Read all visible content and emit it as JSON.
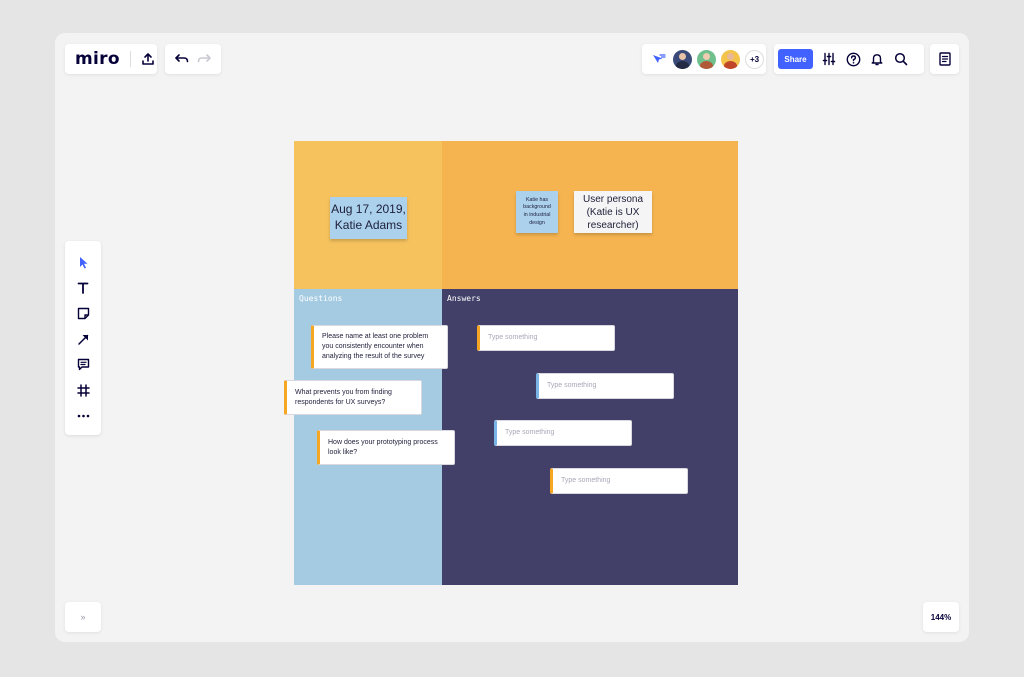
{
  "app": {
    "logo": "miro"
  },
  "collaborators": {
    "more_count": "+3"
  },
  "header": {
    "share_label": "Share"
  },
  "board": {
    "date_sticky": "Aug 17, 2019,\nKatie Adams",
    "background_sticky": "Katie has\nbackground\nin industrial\ndesign",
    "persona_sticky": "User persona\n(Katie is UX\nresearcher)",
    "questions_label": "Questions",
    "answers_label": "Answers",
    "questions": [
      "Please name at least one problem\nyou consistently encounter when\nanalyzing the result of the survey",
      "What prevents you from finding\nrespondents for UX surveys?",
      "How does your prototyping process\nlook like?"
    ],
    "answers": [
      "Type something",
      "Type something",
      "Type something",
      "Type something"
    ]
  },
  "footer": {
    "zoom": "144%",
    "collapse": "»"
  },
  "colors": {
    "accent": "#4262ff",
    "q_top_left": "#f6c25e",
    "q_top_right": "#f6b450",
    "q_bottom_left": "#a5cbe2",
    "q_bottom_right": "#424068"
  },
  "icons": [
    "upload-icon",
    "undo-icon",
    "redo-icon",
    "cursor-follow-icon",
    "settings-sliders-icon",
    "help-icon",
    "bell-icon",
    "search-icon",
    "notes-icon",
    "select-icon",
    "text-icon",
    "sticky-note-icon",
    "arrow-icon",
    "comment-icon",
    "frame-icon",
    "more-icon"
  ]
}
